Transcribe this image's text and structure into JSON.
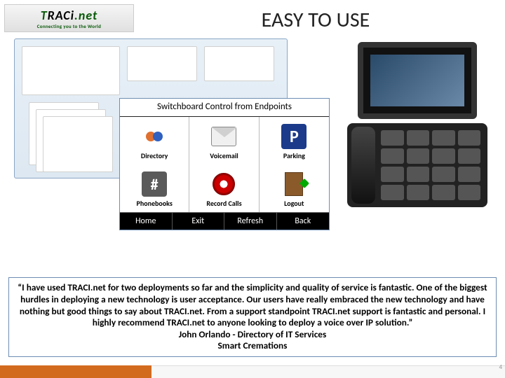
{
  "logo": {
    "brand": "TRACi.net",
    "tagline": "Connecting you to the World"
  },
  "title": "EASY TO USE",
  "switchboard": {
    "heading": "Switchboard Control from Endpoints",
    "items": [
      {
        "label": "Directory"
      },
      {
        "label": "Voicemail"
      },
      {
        "label": "Parking"
      },
      {
        "label": "Phonebooks"
      },
      {
        "label": "Record Calls"
      },
      {
        "label": "Logout"
      }
    ],
    "softkeys": [
      "Home",
      "Exit",
      "Refresh",
      "Back"
    ]
  },
  "testimonial": {
    "quote": "“I have used TRACI.net for two deployments so far and the simplicity and quality of service is fantastic. One of the biggest hurdles in deploying a new technology is user acceptance. Our users have really embraced the new technology and have nothing but good things to say about TRACI.net. From a support standpoint TRACI.net support is fantastic and personal. I highly recommend TRACI.net to anyone looking to deploy a voice over IP solution.”",
    "attribution1": "John Orlando - Directory of IT Services",
    "attribution2": "Smart Cremations"
  },
  "page_number": "4"
}
